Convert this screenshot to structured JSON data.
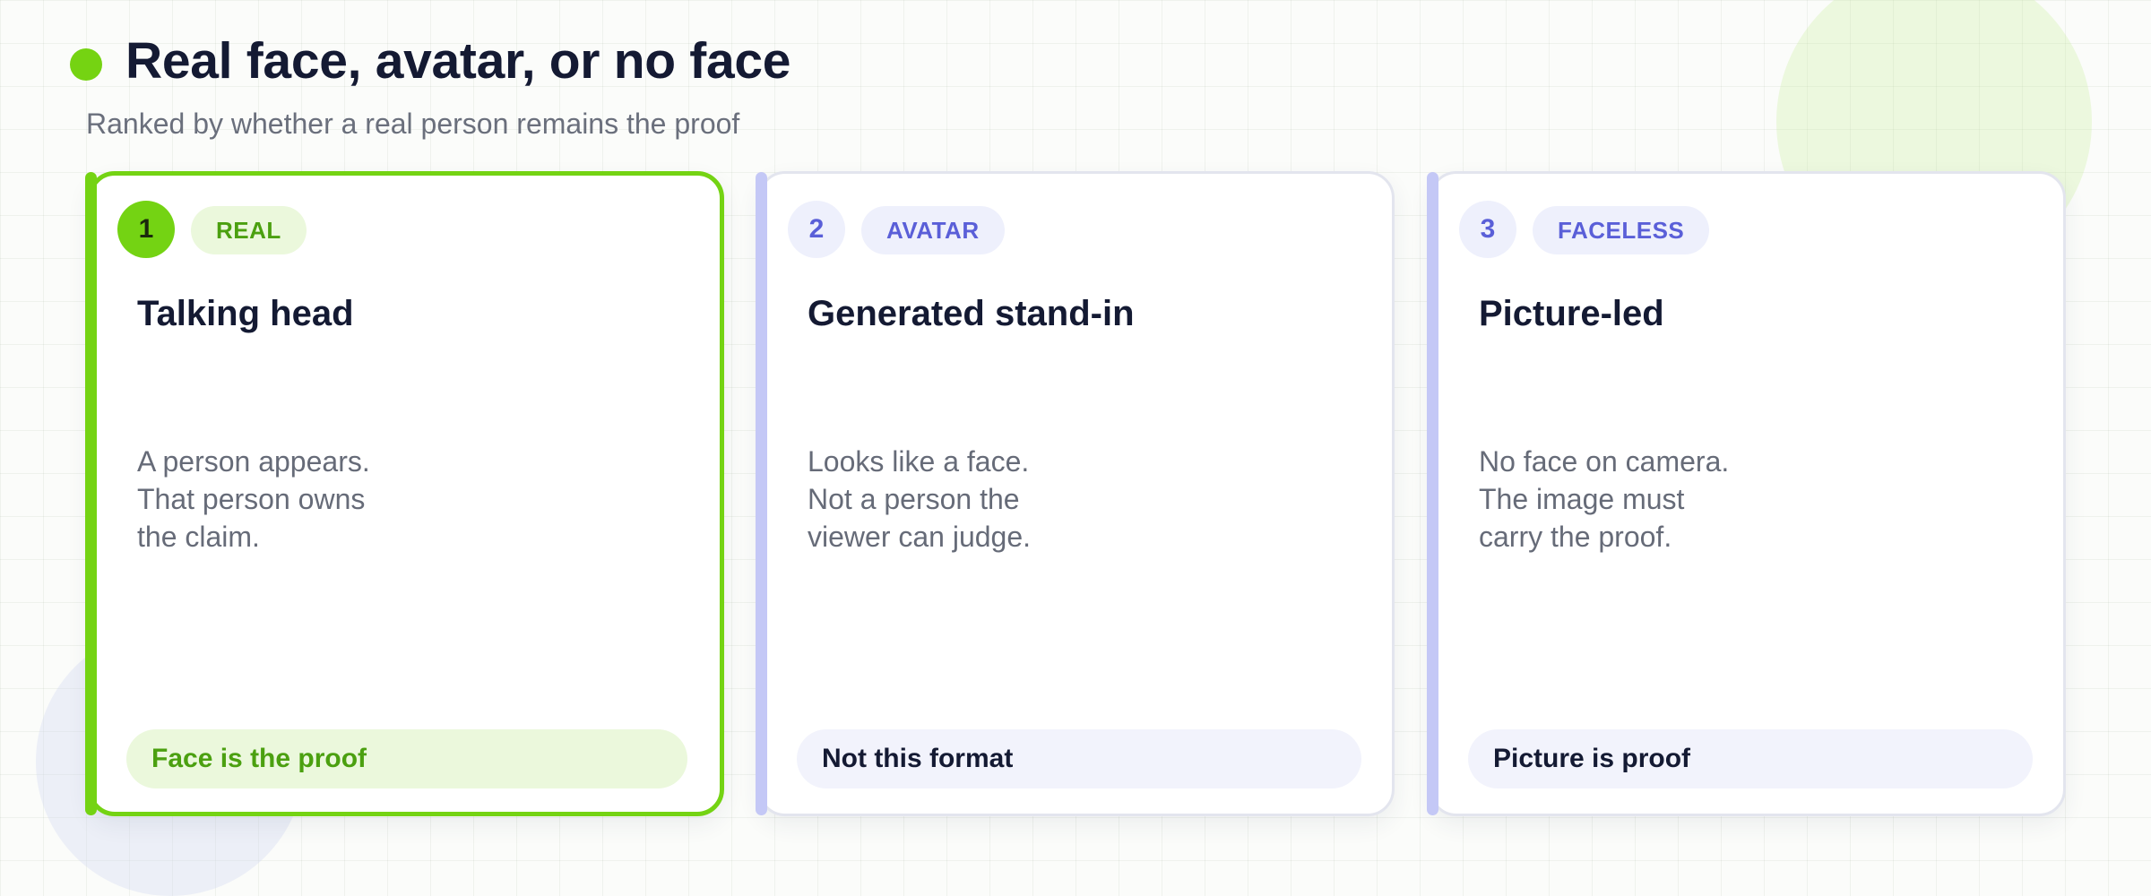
{
  "header": {
    "title": "Real face, avatar, or no face",
    "subtitle": "Ranked by whether a real person remains the proof"
  },
  "colors": {
    "accent_green": "#74d313",
    "accent_violet": "#5a5fd8",
    "violet_rail": "#c4c8f6",
    "pill_green_bg": "#ebf8dc",
    "pill_violet_bg": "#eef0fc",
    "title_text": "#141a33",
    "body_text": "#666b78"
  },
  "cards": [
    {
      "rank": "1",
      "tag": "REAL",
      "title": "Talking head",
      "description_lines": [
        "A person appears.",
        "That person owns",
        "the claim."
      ],
      "verdict": "Face is the proof",
      "selected": true
    },
    {
      "rank": "2",
      "tag": "AVATAR",
      "title": "Generated stand-in",
      "description_lines": [
        "Looks like a face.",
        "Not a person the",
        "viewer can judge."
      ],
      "verdict": "Not this format",
      "selected": false
    },
    {
      "rank": "3",
      "tag": "FACELESS",
      "title": "Picture-led",
      "description_lines": [
        "No face on camera.",
        "The image must",
        "carry the proof."
      ],
      "verdict": "Picture is proof",
      "selected": false
    }
  ]
}
